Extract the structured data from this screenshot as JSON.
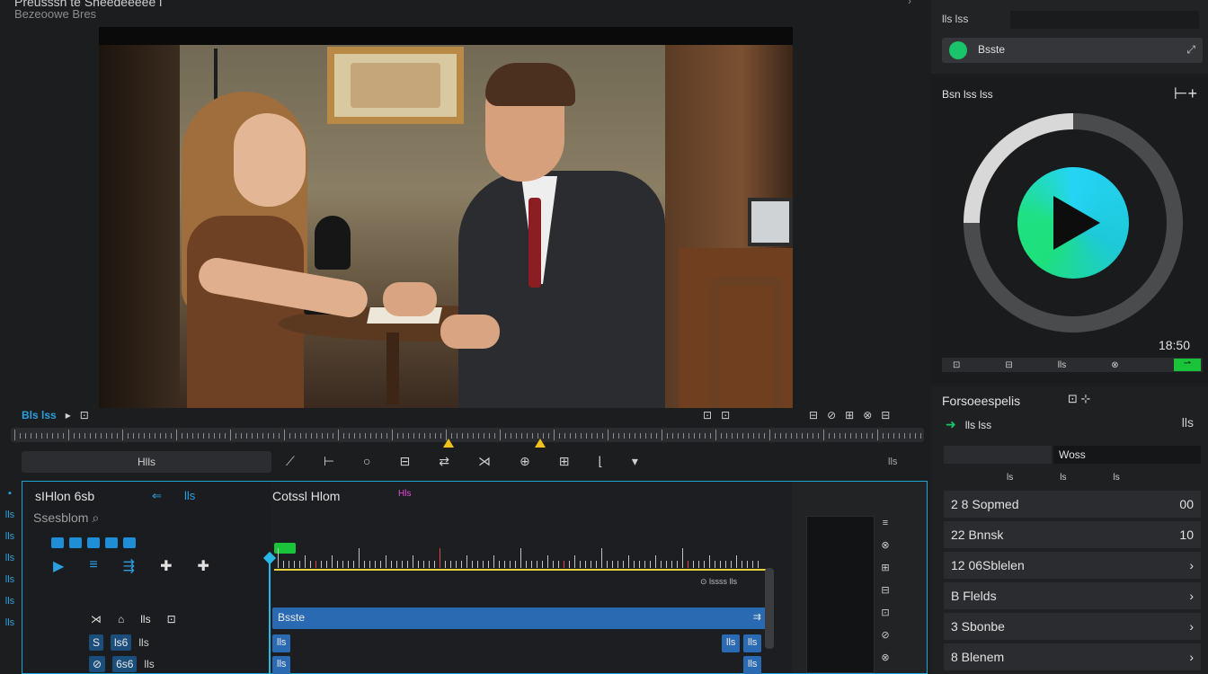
{
  "header": {
    "title": "Preusssh te Sheedeeeee l",
    "subtitle": "Bezeoowe Bres",
    "chevron": "›"
  },
  "viewer": {
    "controls_left": {
      "label": "Bls lss",
      "icons": [
        "▸",
        "⊡"
      ]
    },
    "controls_mid": [
      "⊡",
      "⊡"
    ],
    "controls_right": [
      "⊟",
      "⊘",
      "⊞",
      "⊗",
      "⊟"
    ]
  },
  "toolbar": {
    "box_label": "Hlls",
    "tools": [
      "⟋",
      "⊢",
      "○",
      "⊟",
      "⇄",
      "⋊",
      "⊕",
      "⊞",
      "⌊",
      "▾"
    ],
    "end_label": "lls"
  },
  "timeline": {
    "title": "sIHlon 6sb",
    "subtitle": "Ssesblom",
    "subtitle_icon": "⌕",
    "left_icon1": "⇐",
    "left_icon2": "lls",
    "controls": [
      "▶",
      "≡",
      "⇶",
      "✚",
      "✚"
    ],
    "track_heads": [
      "⋊",
      "⌂",
      "lls",
      "⊡"
    ],
    "rows": [
      {
        "badge": "S",
        "value": "ls6",
        "label": "lls"
      },
      {
        "badge": "⊘",
        "value": "6s6",
        "label": "lls"
      }
    ],
    "clip_name": "Cotssl Hlom",
    "tag": "Hls",
    "info": "⊙ lssss lls",
    "clip": {
      "label": "Bsste",
      "end": "⇉"
    },
    "mini_clips": [
      "lls",
      "lls"
    ],
    "mini_right": [
      "lls",
      "lls",
      "lls"
    ],
    "side_icons": [
      "≡",
      "⊗",
      "⊞",
      "⊟",
      "⊡",
      "⊘",
      "⊗",
      "⊞"
    ]
  },
  "left_strip": [
    "▪",
    "lls",
    "lls",
    "lls",
    "lls",
    "lls",
    "lls"
  ],
  "right_top": {
    "label": "lls lss",
    "bar_label": "Bsste",
    "arrow": "⤢"
  },
  "player": {
    "title": "Bsn lss lss",
    "plus": "⊢+",
    "time": "18:50",
    "bar_items": [
      "⊡",
      "⊟",
      "lls",
      "⊗"
    ],
    "bar_end": "⇀"
  },
  "properties": {
    "title": "Forsoeespelis",
    "icons": "⊡ ⊹",
    "row_label": "lls lss",
    "row_right": "lls",
    "field_value": "Woss",
    "cols": [
      "ls",
      "ls",
      "ls"
    ],
    "items": [
      {
        "label": "2 8 Sopmed",
        "value": "00"
      },
      {
        "label": "22 Bnnsk",
        "value": "10"
      },
      {
        "label": "12 06Sblelen",
        "value": "›"
      },
      {
        "label": "B Flelds",
        "value": "›"
      },
      {
        "label": "3 Sbonbe",
        "value": "›"
      },
      {
        "label": "8 Blenem",
        "value": "›"
      }
    ]
  }
}
